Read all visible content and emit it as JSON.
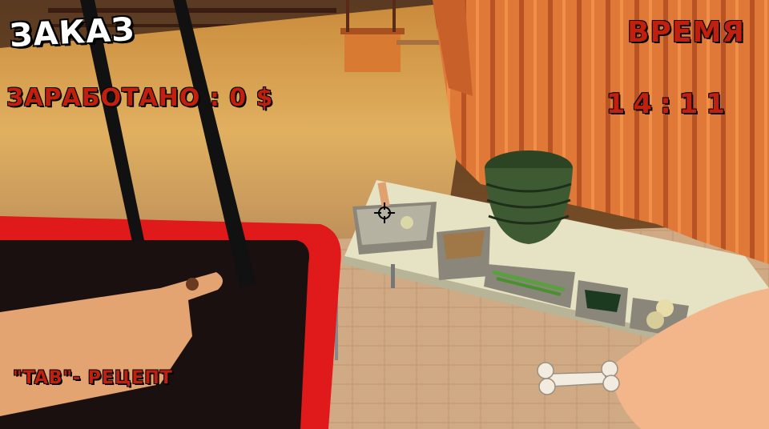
{
  "hud": {
    "order_label": "ЗАКАЗ",
    "earned_text": "ЗАРАБОТАНО : 0 $",
    "time_label": "ВРЕМЯ",
    "time_value": "14:11",
    "hint_text": "\"TAB\"- РЕЦЕПТ"
  },
  "colors": {
    "hud_red": "#c2200f",
    "hud_white": "#ffffff",
    "cart_red": "#e01a1a",
    "floor": "#c9a27a",
    "table": "#e8e4c8",
    "bowl_green": "#3d5a32"
  },
  "icons": {
    "crosshair": "crosshair-icon",
    "bone": "bone-icon"
  }
}
